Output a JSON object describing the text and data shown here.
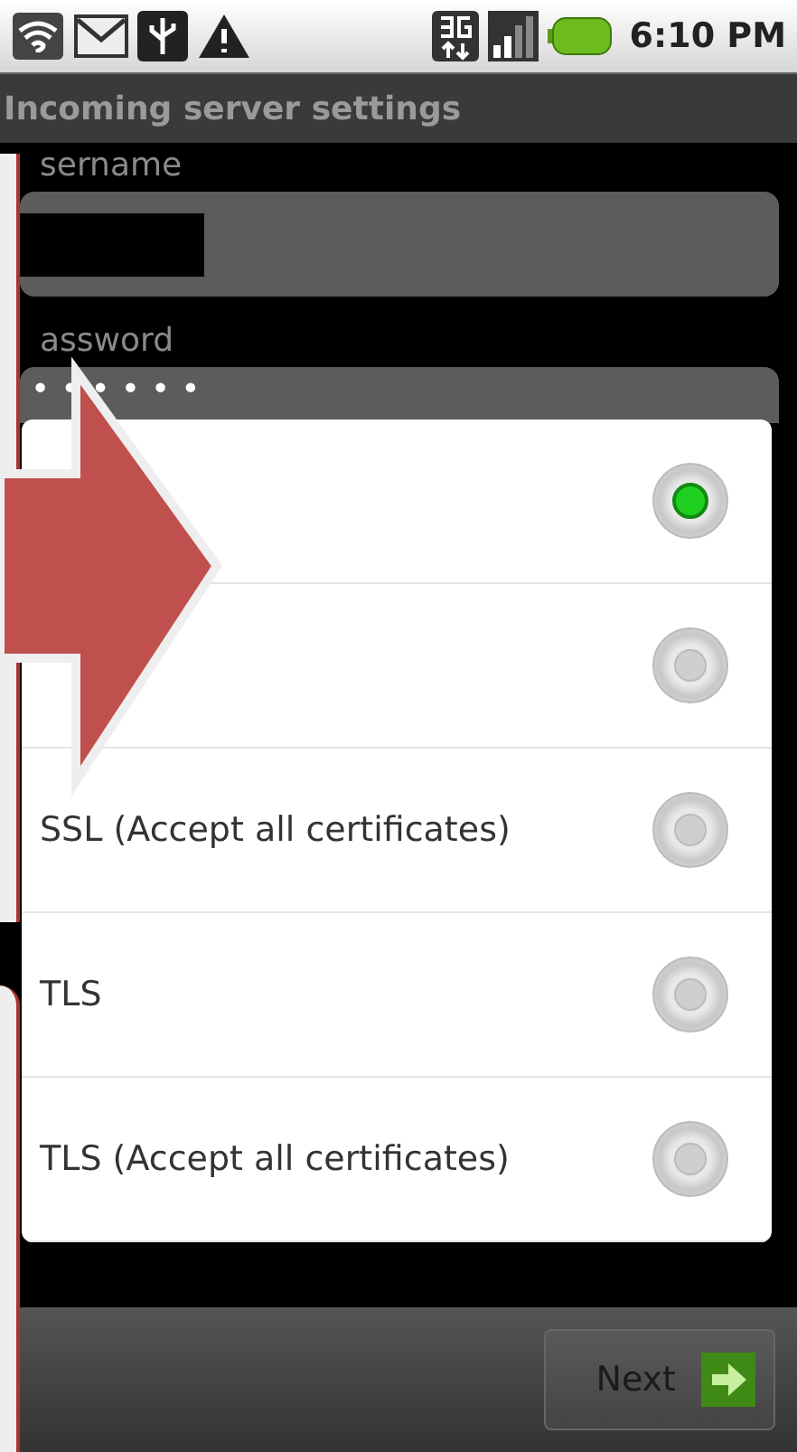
{
  "status_bar": {
    "time": "6:10 PM"
  },
  "window": {
    "title": "Incoming server settings"
  },
  "fields": [
    {
      "label": "sername",
      "redacted": true
    },
    {
      "label": "assword",
      "value": "••••••",
      "redacted": false
    }
  ],
  "dialog": {
    "options": [
      {
        "selected": true
      },
      {
        "selected": false
      },
      {
        "label": "SSL (Accept all certificates)",
        "selected": false
      },
      {
        "label": "TLS",
        "selected": false
      },
      {
        "label": "TLS (Accept all certificates)",
        "selected": false
      }
    ]
  },
  "buttons": [
    {
      "label": "Next"
    }
  ]
}
